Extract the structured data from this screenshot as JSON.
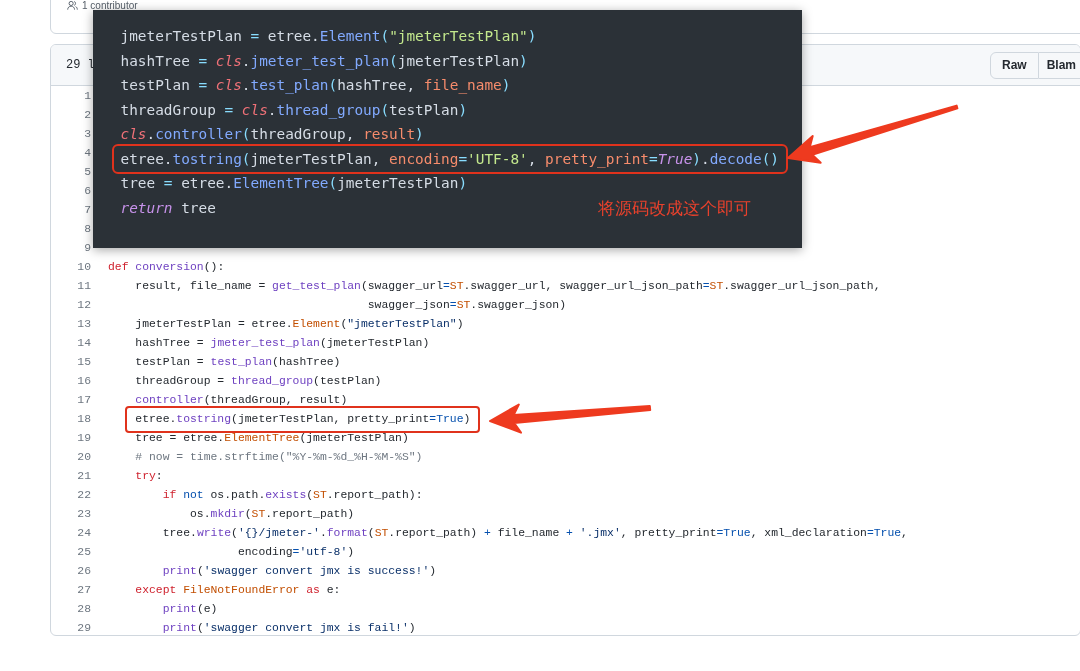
{
  "contributors_bar": {
    "label": "1 contributor"
  },
  "file_view": {
    "line_count": "29 l",
    "buttons": [
      {
        "label": "Raw"
      },
      {
        "label": "Blam"
      }
    ],
    "lines": [
      {
        "number": "1"
      },
      {
        "number": "2"
      },
      {
        "number": "3"
      },
      {
        "number": "4"
      },
      {
        "number": "5"
      },
      {
        "number": "6"
      },
      {
        "number": "7"
      },
      {
        "number": "8"
      },
      {
        "number": "9"
      },
      {
        "number": "10",
        "highlighted": false,
        "tokens": [
          {
            "text": "def",
            "kind": "keyword"
          },
          {
            "text": " conversion",
            "kind": "function"
          },
          {
            "text": "():",
            "kind": "plain"
          }
        ]
      },
      {
        "number": "11",
        "highlighted": false,
        "tokens": [
          {
            "text": "    result, file_name = ",
            "kind": "plain"
          },
          {
            "text": "get_test_plan",
            "kind": "function"
          },
          {
            "text": "(swagger_url",
            "kind": "plain"
          },
          {
            "text": "=",
            "kind": "constant"
          },
          {
            "text": "ST",
            "kind": "class"
          },
          {
            "text": ".swagger_url, swagger_url_json_path",
            "kind": "plain"
          },
          {
            "text": "=",
            "kind": "constant"
          },
          {
            "text": "ST",
            "kind": "class"
          },
          {
            "text": ".swagger_url_json_path,",
            "kind": "plain"
          }
        ]
      },
      {
        "number": "12",
        "highlighted": false,
        "tokens": [
          {
            "text": "                                      swagger_json",
            "kind": "plain"
          },
          {
            "text": "=",
            "kind": "constant"
          },
          {
            "text": "ST",
            "kind": "class"
          },
          {
            "text": ".swagger_json)",
            "kind": "plain"
          }
        ]
      },
      {
        "number": "13",
        "highlighted": false,
        "tokens": [
          {
            "text": "    jmeterTestPlan = etree.",
            "kind": "plain"
          },
          {
            "text": "Element",
            "kind": "class"
          },
          {
            "text": "(",
            "kind": "plain"
          },
          {
            "text": "\"jmeterTestPlan\"",
            "kind": "string"
          },
          {
            "text": ")",
            "kind": "plain"
          }
        ]
      },
      {
        "number": "14",
        "highlighted": false,
        "tokens": [
          {
            "text": "    hashTree = ",
            "kind": "plain"
          },
          {
            "text": "jmeter_test_plan",
            "kind": "function"
          },
          {
            "text": "(jmeterTestPlan)",
            "kind": "plain"
          }
        ]
      },
      {
        "number": "15",
        "highlighted": false,
        "tokens": [
          {
            "text": "    testPlan = ",
            "kind": "plain"
          },
          {
            "text": "test_plan",
            "kind": "function"
          },
          {
            "text": "(hashTree)",
            "kind": "plain"
          }
        ]
      },
      {
        "number": "16",
        "highlighted": false,
        "tokens": [
          {
            "text": "    threadGroup = ",
            "kind": "plain"
          },
          {
            "text": "thread_group",
            "kind": "function"
          },
          {
            "text": "(testPlan)",
            "kind": "plain"
          }
        ]
      },
      {
        "number": "17",
        "highlighted": false,
        "tokens": [
          {
            "text": "    controller",
            "kind": "function"
          },
          {
            "text": "(threadGroup, result)",
            "kind": "plain"
          }
        ]
      },
      {
        "number": "18",
        "highlighted": true,
        "tokens": [
          {
            "text": "    etree.",
            "kind": "plain"
          },
          {
            "text": "tostring",
            "kind": "function"
          },
          {
            "text": "(jmeterTestPlan, pretty_print",
            "kind": "plain"
          },
          {
            "text": "=",
            "kind": "constant"
          },
          {
            "text": "True",
            "kind": "constant"
          },
          {
            "text": ")",
            "kind": "plain"
          }
        ]
      },
      {
        "number": "19",
        "highlighted": false,
        "tokens": [
          {
            "text": "    tree = etree.",
            "kind": "plain"
          },
          {
            "text": "ElementTree",
            "kind": "class"
          },
          {
            "text": "(jmeterTestPlan)",
            "kind": "plain"
          }
        ]
      },
      {
        "number": "20",
        "highlighted": false,
        "tokens": [
          {
            "text": "    # now = time.strftime(\"%Y-%m-%d_%H-%M-%S\")",
            "kind": "comment"
          }
        ]
      },
      {
        "number": "21",
        "highlighted": false,
        "tokens": [
          {
            "text": "    try",
            "kind": "keyword"
          },
          {
            "text": ":",
            "kind": "plain"
          }
        ]
      },
      {
        "number": "22",
        "highlighted": false,
        "tokens": [
          {
            "text": "        if",
            "kind": "keyword"
          },
          {
            "text": " not",
            "kind": "constant"
          },
          {
            "text": " os.path.",
            "kind": "plain"
          },
          {
            "text": "exists",
            "kind": "function"
          },
          {
            "text": "(",
            "kind": "plain"
          },
          {
            "text": "ST",
            "kind": "class"
          },
          {
            "text": ".report_path):",
            "kind": "plain"
          }
        ]
      },
      {
        "number": "23",
        "highlighted": false,
        "tokens": [
          {
            "text": "            os.",
            "kind": "plain"
          },
          {
            "text": "mkdir",
            "kind": "function"
          },
          {
            "text": "(",
            "kind": "plain"
          },
          {
            "text": "ST",
            "kind": "class"
          },
          {
            "text": ".report_path)",
            "kind": "plain"
          }
        ]
      },
      {
        "number": "24",
        "highlighted": false,
        "tokens": [
          {
            "text": "        tree.",
            "kind": "plain"
          },
          {
            "text": "write",
            "kind": "function"
          },
          {
            "text": "(",
            "kind": "plain"
          },
          {
            "text": "'{}/jmeter-'",
            "kind": "string"
          },
          {
            "text": ".",
            "kind": "plain"
          },
          {
            "text": "format",
            "kind": "function"
          },
          {
            "text": "(",
            "kind": "plain"
          },
          {
            "text": "ST",
            "kind": "class"
          },
          {
            "text": ".report_path) ",
            "kind": "plain"
          },
          {
            "text": "+",
            "kind": "constant"
          },
          {
            "text": " file_name ",
            "kind": "plain"
          },
          {
            "text": "+",
            "kind": "constant"
          },
          {
            "text": " '.jmx'",
            "kind": "string"
          },
          {
            "text": ", pretty_print",
            "kind": "plain"
          },
          {
            "text": "=",
            "kind": "constant"
          },
          {
            "text": "True",
            "kind": "constant"
          },
          {
            "text": ", xml_declaration",
            "kind": "plain"
          },
          {
            "text": "=",
            "kind": "constant"
          },
          {
            "text": "True",
            "kind": "constant"
          },
          {
            "text": ",",
            "kind": "plain"
          }
        ]
      },
      {
        "number": "25",
        "highlighted": false,
        "tokens": [
          {
            "text": "                   encoding",
            "kind": "plain"
          },
          {
            "text": "=",
            "kind": "constant"
          },
          {
            "text": "'utf-8'",
            "kind": "string"
          },
          {
            "text": ")",
            "kind": "plain"
          }
        ]
      },
      {
        "number": "26",
        "highlighted": false,
        "tokens": [
          {
            "text": "        print",
            "kind": "function"
          },
          {
            "text": "(",
            "kind": "plain"
          },
          {
            "text": "'swagger convert jmx is success!'",
            "kind": "string"
          },
          {
            "text": ")",
            "kind": "plain"
          }
        ]
      },
      {
        "number": "27",
        "highlighted": false,
        "tokens": [
          {
            "text": "    except",
            "kind": "keyword"
          },
          {
            "text": " FileNotFoundError",
            "kind": "class"
          },
          {
            "text": " as",
            "kind": "keyword"
          },
          {
            "text": " e:",
            "kind": "plain"
          }
        ]
      },
      {
        "number": "28",
        "highlighted": false,
        "tokens": [
          {
            "text": "        print",
            "kind": "function"
          },
          {
            "text": "(e)",
            "kind": "plain"
          }
        ]
      },
      {
        "number": "29",
        "highlighted": false,
        "tokens": [
          {
            "text": "        print",
            "kind": "function"
          },
          {
            "text": "(",
            "kind": "plain"
          },
          {
            "text": "'swagger convert jmx is fail!'",
            "kind": "string"
          },
          {
            "text": ")",
            "kind": "plain"
          }
        ]
      }
    ]
  },
  "overlay_snippet": {
    "lines": [
      {
        "highlighted": false,
        "tokens": [
          {
            "text": "jmeterTestPlan ",
            "kind": "plain"
          },
          {
            "text": "=",
            "kind": "punct"
          },
          {
            "text": " etree.",
            "kind": "plain"
          },
          {
            "text": "Element",
            "kind": "function"
          },
          {
            "text": "(",
            "kind": "punct"
          },
          {
            "text": "\"jmeterTestPlan\"",
            "kind": "string"
          },
          {
            "text": ")",
            "kind": "punct"
          }
        ]
      },
      {
        "highlighted": false,
        "tokens": [
          {
            "text": "hashTree ",
            "kind": "plain"
          },
          {
            "text": "=",
            "kind": "punct"
          },
          {
            "text": " cls",
            "kind": "self"
          },
          {
            "text": ".",
            "kind": "plain"
          },
          {
            "text": "jmeter_test_plan",
            "kind": "function"
          },
          {
            "text": "(",
            "kind": "punct"
          },
          {
            "text": "jmeterTestPlan",
            "kind": "plain"
          },
          {
            "text": ")",
            "kind": "punct"
          }
        ]
      },
      {
        "highlighted": false,
        "tokens": [
          {
            "text": "testPlan ",
            "kind": "plain"
          },
          {
            "text": "=",
            "kind": "punct"
          },
          {
            "text": " cls",
            "kind": "self"
          },
          {
            "text": ".",
            "kind": "plain"
          },
          {
            "text": "test_plan",
            "kind": "function"
          },
          {
            "text": "(",
            "kind": "punct"
          },
          {
            "text": "hashTree, ",
            "kind": "plain"
          },
          {
            "text": "file_name",
            "kind": "param"
          },
          {
            "text": ")",
            "kind": "punct"
          }
        ]
      },
      {
        "highlighted": false,
        "tokens": [
          {
            "text": "threadGroup ",
            "kind": "plain"
          },
          {
            "text": "=",
            "kind": "punct"
          },
          {
            "text": " cls",
            "kind": "self"
          },
          {
            "text": ".",
            "kind": "plain"
          },
          {
            "text": "thread_group",
            "kind": "function"
          },
          {
            "text": "(",
            "kind": "punct"
          },
          {
            "text": "testPlan",
            "kind": "plain"
          },
          {
            "text": ")",
            "kind": "punct"
          }
        ]
      },
      {
        "highlighted": false,
        "tokens": [
          {
            "text": "cls",
            "kind": "self"
          },
          {
            "text": ".",
            "kind": "plain"
          },
          {
            "text": "controller",
            "kind": "function"
          },
          {
            "text": "(",
            "kind": "punct"
          },
          {
            "text": "threadGroup, ",
            "kind": "plain"
          },
          {
            "text": "result",
            "kind": "param"
          },
          {
            "text": ")",
            "kind": "punct"
          }
        ]
      },
      {
        "highlighted": true,
        "tokens": [
          {
            "text": "etree.",
            "kind": "plain"
          },
          {
            "text": "tostring",
            "kind": "function"
          },
          {
            "text": "(",
            "kind": "punct"
          },
          {
            "text": "jmeterTestPlan, ",
            "kind": "plain"
          },
          {
            "text": "encoding",
            "kind": "param"
          },
          {
            "text": "=",
            "kind": "punct"
          },
          {
            "text": "'UTF-8'",
            "kind": "string"
          },
          {
            "text": ", ",
            "kind": "plain"
          },
          {
            "text": "pretty_print",
            "kind": "param"
          },
          {
            "text": "=",
            "kind": "punct"
          },
          {
            "text": "True",
            "kind": "keyword"
          },
          {
            "text": ")",
            "kind": "punct"
          },
          {
            "text": ".",
            "kind": "plain"
          },
          {
            "text": "decode",
            "kind": "function"
          },
          {
            "text": "()",
            "kind": "punct"
          }
        ]
      },
      {
        "highlighted": false,
        "tokens": [
          {
            "text": "tree ",
            "kind": "plain"
          },
          {
            "text": "=",
            "kind": "punct"
          },
          {
            "text": " etree.",
            "kind": "plain"
          },
          {
            "text": "ElementTree",
            "kind": "function"
          },
          {
            "text": "(",
            "kind": "punct"
          },
          {
            "text": "jmeterTestPlan",
            "kind": "plain"
          },
          {
            "text": ")",
            "kind": "punct"
          }
        ]
      },
      {
        "highlighted": false,
        "tokens": [
          {
            "text": "return",
            "kind": "keyword"
          },
          {
            "text": " tree",
            "kind": "plain"
          }
        ]
      }
    ],
    "note": "将源码改成这个即可"
  }
}
